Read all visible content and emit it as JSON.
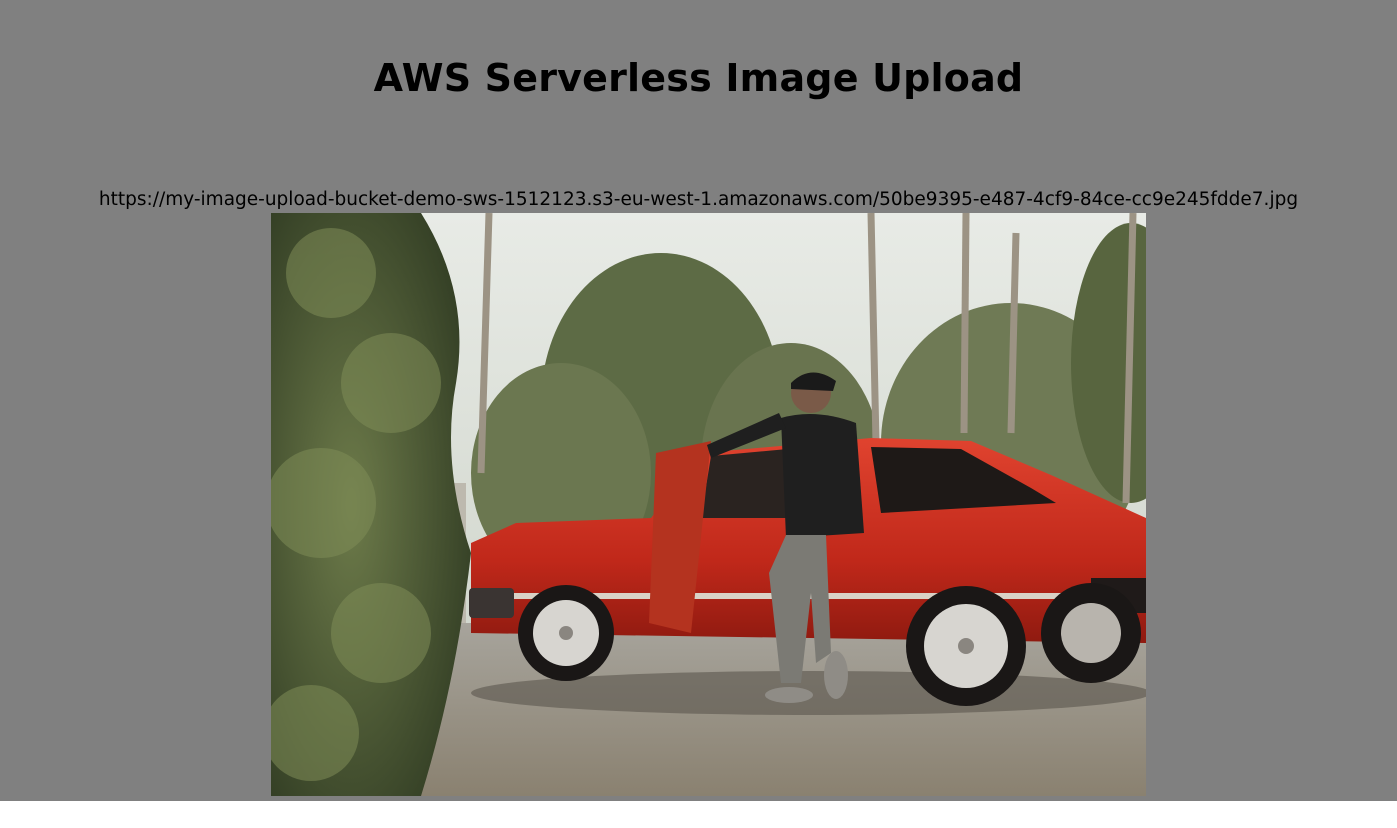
{
  "page": {
    "title": "AWS Serverless Image Upload",
    "background_color": "#808080"
  },
  "uploaded_image": {
    "url": "https://my-image-upload-bucket-demo-sws-1512123.s3-eu-west-1.amazonaws.com/50be9395-e487-4cf9-84ce-cc9e245fdde7.jpg",
    "accent_color": "#c8281c"
  }
}
